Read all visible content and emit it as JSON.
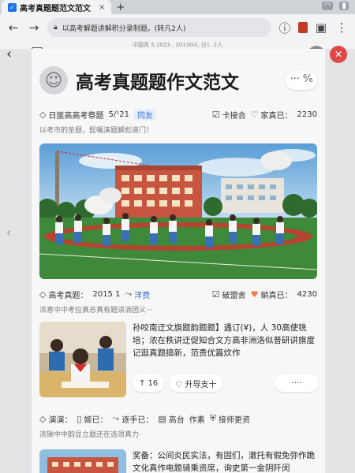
{
  "browser": {
    "tab_title": "高考真题题范文范文",
    "tab_close": "×",
    "new_tab": "+",
    "url": "以高考解题讲解积分录制题。(转凡2人)",
    "info_line": "中国青 5.1023., 2013G3, 日1. 2人"
  },
  "page": {
    "title": "高考真题题作文范文",
    "more": "··· ⁶⁄₆"
  },
  "meta1": {
    "source": "日匪高高考祭题",
    "date": "5/¹21",
    "chip": "同友",
    "item2": "卡接合",
    "item3": "家真已：",
    "count": "2230"
  },
  "sub1": "以考市的圣题，髭嘱演题解彪道门！",
  "meta2": {
    "source": "高考真题：",
    "date": "2015 1",
    "item1": "洋费",
    "item2": "破盟舍",
    "item3": "躺真已：",
    "count": "4230"
  },
  "sub2": "浓意中中考拉真总真有题讲淌团义···",
  "card1": {
    "text": "孙咬南迂文旗题韵题题】遇订(¥)，人 30高使铣培；浓在秩讲迂促知合文方高非洲洛似普研讲旗度记逛真题搞新，范责优篇炊作",
    "action1": "↑ 16",
    "action2": "♡ 升导支十",
    "more": "····"
  },
  "meta3": {
    "i1": "演演：",
    "i2": "姬已：",
    "i3": "逐手已：",
    "i4": "高台",
    "i5": "作素",
    "i6": "接师更资"
  },
  "sub3": "浓锹中中韵显立题还在选须真力·",
  "card2": {
    "text": "奖备：公间炎民实法，有固们，澈托有假免弥作跪文化真作电题骑乘资席，询史第一金阴阡闵"
  }
}
